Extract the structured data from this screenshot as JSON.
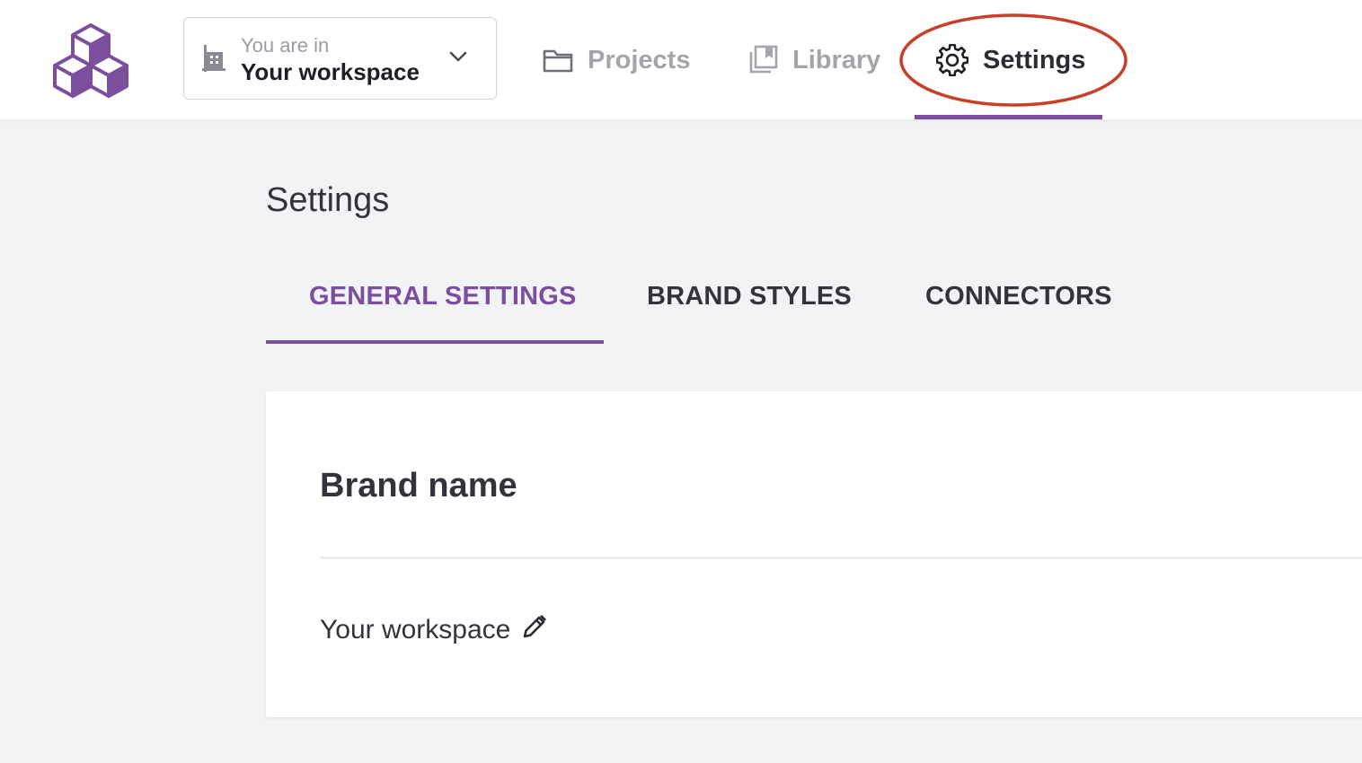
{
  "colors": {
    "brand": "#7b4f9e",
    "highlight": "#c8402a"
  },
  "header": {
    "logo": "cubes-logo",
    "workspace_switcher": {
      "label": "You are in",
      "value": "Your workspace",
      "icon": "building-icon"
    },
    "nav": [
      {
        "label": "Projects",
        "icon": "folder-icon",
        "active": false
      },
      {
        "label": "Library",
        "icon": "library-icon",
        "active": false
      },
      {
        "label": "Settings",
        "icon": "gear-icon",
        "active": true
      }
    ]
  },
  "main": {
    "title": "Settings",
    "tabs": [
      {
        "label": "GENERAL SETTINGS",
        "active": true
      },
      {
        "label": "BRAND STYLES",
        "active": false
      },
      {
        "label": "CONNECTORS",
        "active": false
      }
    ],
    "card": {
      "title": "Brand name",
      "value": "Your workspace",
      "edit_icon": "pencil-icon"
    }
  }
}
